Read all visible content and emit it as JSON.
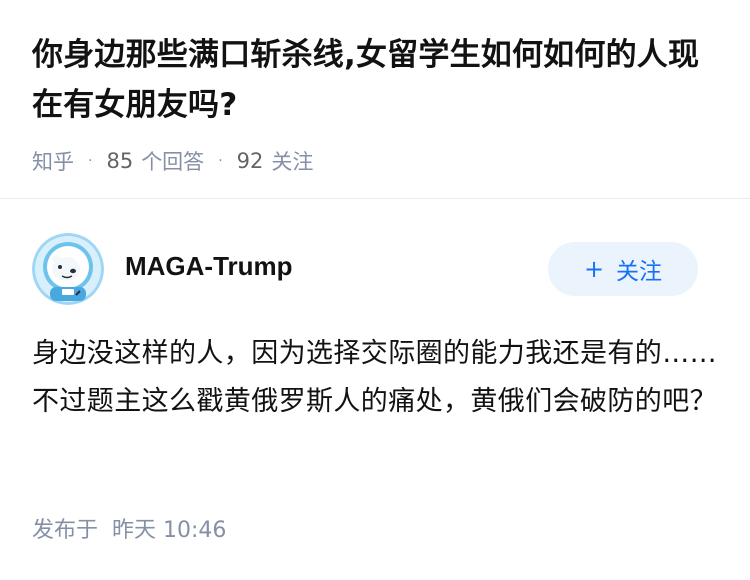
{
  "question": {
    "title": "你身边那些满口斩杀线,女留学生如何如何的人现在有女朋友吗?",
    "source": "知乎",
    "answer_count": "85",
    "answer_label": "个回答",
    "follower_count": "92",
    "follower_label": "关注"
  },
  "answer": {
    "author_name": "MAGA-Trump",
    "follow_icon": "plus-icon",
    "follow_label": "关注",
    "content": "身边没这样的人，因为选择交际圈的能力我还是有的……不过题主这么戳黄俄罗斯人的痛处，黄俄们会破防的吧？",
    "publish_label": "发布于",
    "publish_time": "昨天 10:46"
  },
  "colors": {
    "accent": "#1772f6",
    "button_bg": "#ebf3fd",
    "meta": "#8590a6",
    "text": "#121212"
  }
}
